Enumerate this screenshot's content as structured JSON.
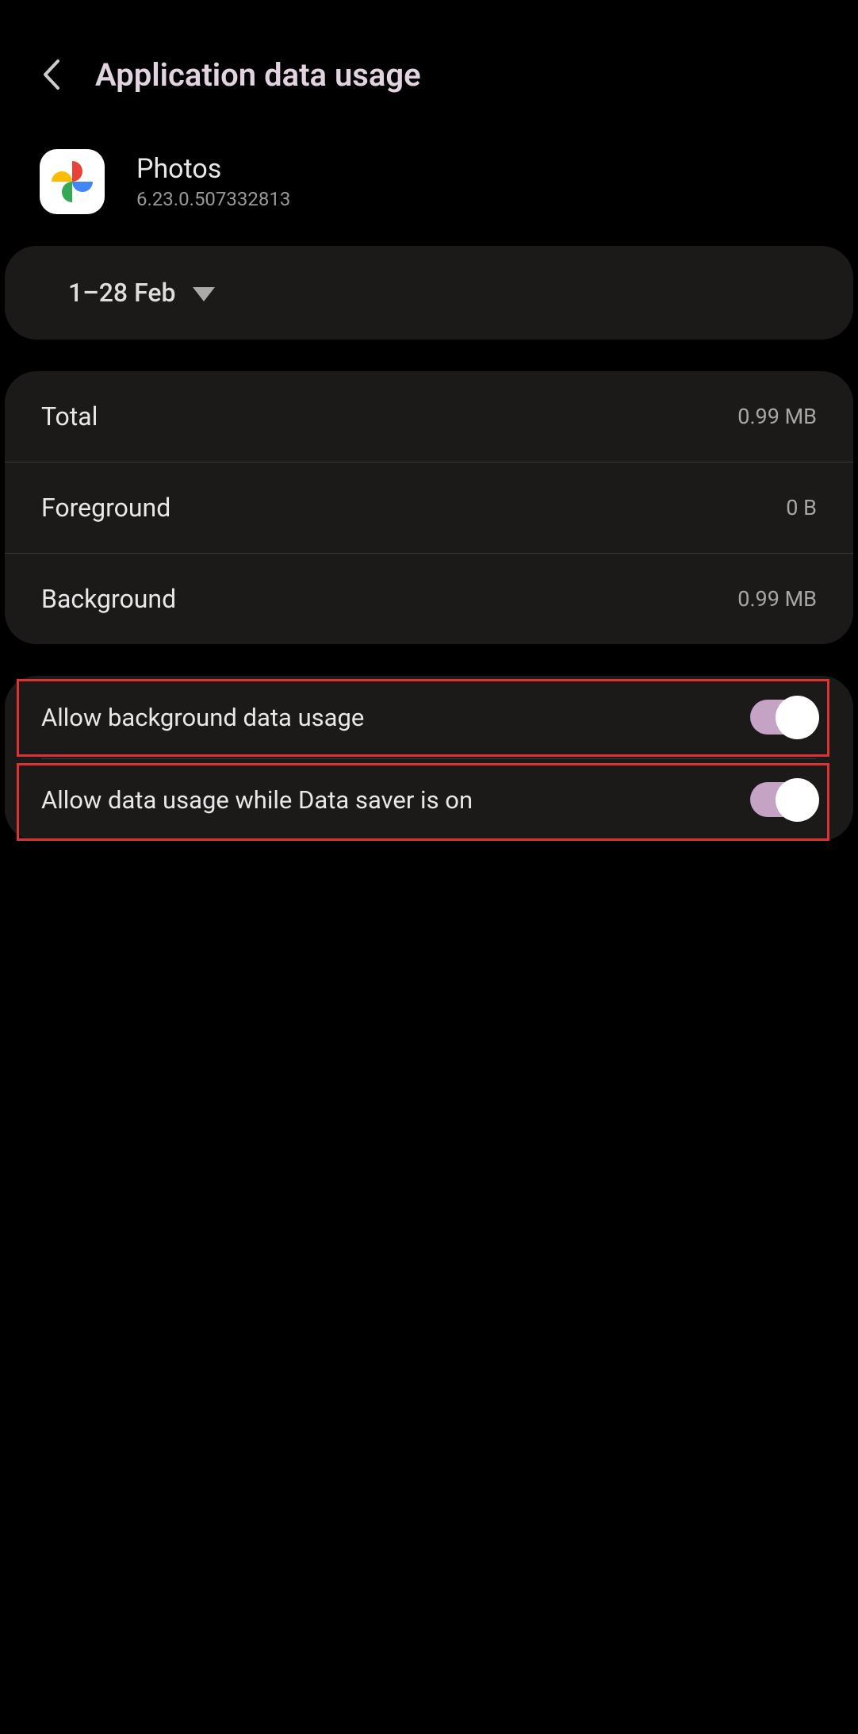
{
  "header": {
    "title": "Application data usage"
  },
  "app": {
    "name": "Photos",
    "version": "6.23.0.507332813"
  },
  "date_range": {
    "label": "1–28 Feb"
  },
  "stats": {
    "total": {
      "label": "Total",
      "value": "0.99 MB"
    },
    "foreground": {
      "label": "Foreground",
      "value": "0 B"
    },
    "background": {
      "label": "Background",
      "value": "0.99 MB"
    }
  },
  "toggles": {
    "bg_data": {
      "label": "Allow background data usage",
      "on": true
    },
    "data_saver": {
      "label": "Allow data usage while Data saver is on",
      "on": true
    }
  }
}
